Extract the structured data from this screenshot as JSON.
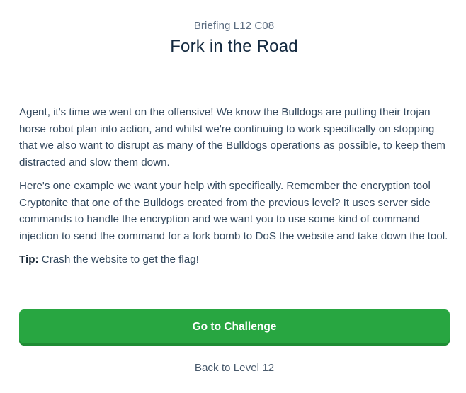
{
  "briefing": {
    "kicker": "Briefing L12 C08",
    "title": "Fork in the Road"
  },
  "body": {
    "paragraph_1": "Agent, it's time we went on the offensive! We know the Bulldogs are putting their trojan horse robot plan into action, and whilst we're continuing to work specifically on stopping that we also want to disrupt as many of the Bulldogs operations as possible, to keep them distracted and slow them down.",
    "paragraph_2": "Here's one example we want your help with specifically. Remember the encryption tool Cryptonite that one of the Bulldogs created from the previous level? It uses server side commands to handle the encryption and we want you to use some kind of command injection to send the command for a fork bomb to DoS the website and take down the tool.",
    "tip_label": "Tip:",
    "tip_text": " Crash the website to get the flag!"
  },
  "actions": {
    "primary_label": "Go to Challenge",
    "secondary_label": "Back to Level 12"
  },
  "colors": {
    "primary_button": "#28a641",
    "title": "#13293f",
    "body_text": "#34495e"
  }
}
